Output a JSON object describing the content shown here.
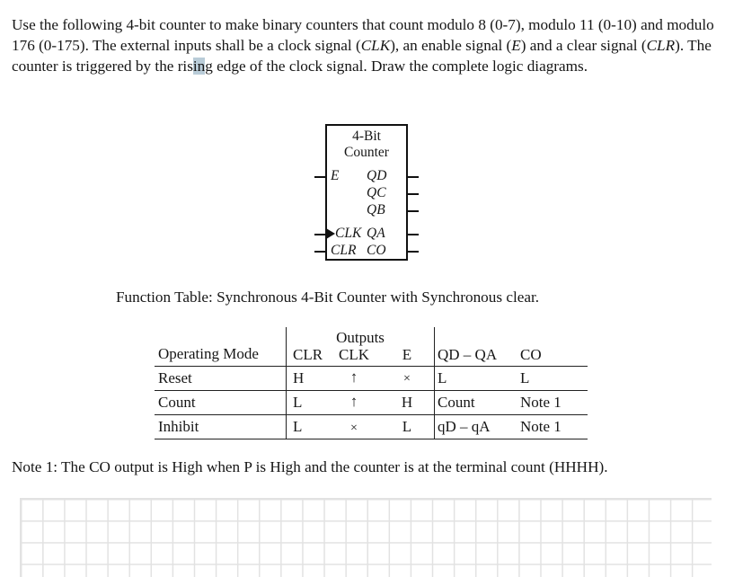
{
  "document": {
    "problem_statement": {
      "segments": [
        {
          "t": "Use the following 4-bit counter to make binary counters that count modulo 8 (0-7), modulo 11 (0-10) and modulo 176 (0-175).  The external inputs shall be a clock signal (",
          "style": "normal"
        },
        {
          "t": "CLK",
          "style": "italic"
        },
        {
          "t": "), an enable signal (",
          "style": "normal"
        },
        {
          "t": "E",
          "style": "italic"
        },
        {
          "t": ") and a clear signal (",
          "style": "normal"
        },
        {
          "t": "CLR",
          "style": "italic"
        },
        {
          "t": ").  The counter is triggered by the ris",
          "style": "normal"
        },
        {
          "t": "in",
          "style": "selected"
        },
        {
          "t": "g edge of the clock signal.  Draw the complete logic diagrams.",
          "style": "normal"
        }
      ],
      "plain": "Use the following 4-bit counter to make binary counters that count modulo 8 (0-7), modulo 11 (0-10) and modulo 176 (0-175).  The external inputs shall be a clock signal (CLK), an enable signal (E) and a clear signal (CLR).  The counter is triggered by the rising edge of the clock signal.  Draw the complete logic diagrams.",
      "selection_highlight_color": "#b9ccd8"
    },
    "counter_symbol": {
      "title_line1": "4-Bit",
      "title_line2": "Counter",
      "inputs": [
        {
          "label": "E",
          "clock_edge": false
        },
        {
          "label": "CLK",
          "clock_edge": true
        },
        {
          "label": "CLR",
          "clock_edge": false
        }
      ],
      "outputs": [
        "QD",
        "QC",
        "QB",
        "QA",
        "CO"
      ]
    },
    "function_table_caption": "Function Table:  Synchronous 4-Bit Counter with Synchronous clear.",
    "function_table": {
      "group_header": "Outputs",
      "columns": [
        "Operating Mode",
        "CLR",
        "CLK",
        "E",
        "QD – QA",
        "CO"
      ],
      "rows": [
        {
          "mode": "Reset",
          "clr": "H",
          "clk": "↑",
          "e": "×",
          "q": "L",
          "co": "L"
        },
        {
          "mode": "Count",
          "clr": "L",
          "clk": "↑",
          "e": "H",
          "q": "Count",
          "co": "Note 1"
        },
        {
          "mode": "Inhibit",
          "clr": "L",
          "clk": "×",
          "e": "L",
          "q": "qD – qA",
          "co": "Note 1"
        }
      ]
    },
    "note1": "Note 1:  The CO output is High when P is High and the counter is at the terminal count (HHHH)."
  }
}
